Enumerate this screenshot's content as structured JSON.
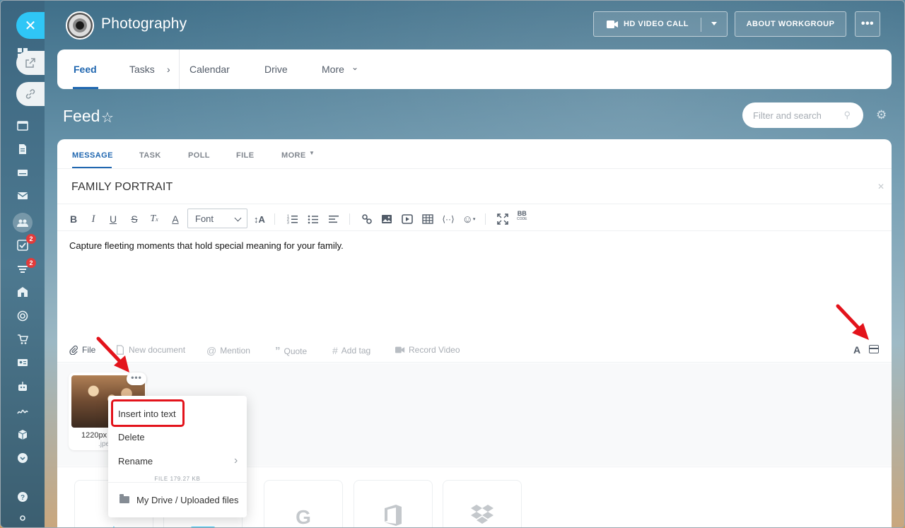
{
  "header": {
    "group_title": "Photography",
    "video_call_label": "HD VIDEO CALL",
    "about_label": "ABOUT WORKGROUP",
    "more_label": "•••"
  },
  "nav": {
    "tabs": [
      {
        "label": "Feed"
      },
      {
        "label": "Tasks"
      },
      {
        "label": "Calendar"
      },
      {
        "label": "Drive"
      },
      {
        "label": "More"
      }
    ]
  },
  "sidebar": {
    "badges": [
      "2",
      "2"
    ]
  },
  "feed": {
    "title": "Feed",
    "filter_placeholder": "Filter and search"
  },
  "composer": {
    "tabs": [
      "MESSAGE",
      "TASK",
      "POLL",
      "FILE",
      "MORE"
    ],
    "subject": "FAMILY PORTRAIT",
    "font_label": "Font",
    "bbcode_label": "BB",
    "bbcode_sub": "CODE",
    "body_text": "Capture fleeting moments that hold special meaning for your family.",
    "bottom_tools": {
      "file": "File",
      "new_document": "New document",
      "mention": "Mention",
      "quote": "Quote",
      "add_tag": "Add tag",
      "record_video": "Record Video"
    },
    "format_label": "A"
  },
  "attachment": {
    "name": "1220px",
    "ext": ".jpe",
    "dots": "•••"
  },
  "context_menu": {
    "insert": "Insert into text",
    "delete": "Delete",
    "rename": "Rename",
    "size": "FILE 179.27 KB",
    "path": "My Drive / Uploaded files"
  },
  "colors": {
    "accent": "#2067b0",
    "close_button": "#2fc6f6",
    "highlight": "#e3131b",
    "badge": "#e23b3b"
  }
}
